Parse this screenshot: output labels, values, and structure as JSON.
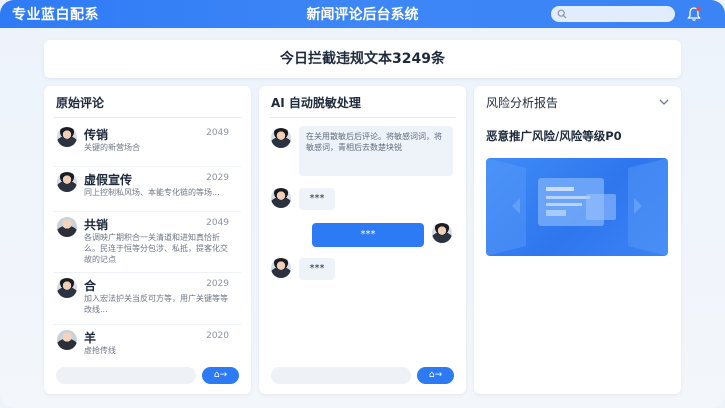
{
  "header": {
    "brand": "专业蓝白配系",
    "title": "新闻评论后台系统",
    "search_placeholder": ""
  },
  "stat_banner": {
    "text": "今日拦截违规文本3249条"
  },
  "panels": {
    "original": {
      "title": "原始评论",
      "comments": [
        {
          "name": "传销",
          "count": "2049",
          "text": "关键的新营场合"
        },
        {
          "name": "虚假宣传",
          "count": "2029",
          "text": "同上控制私风场、本能专化链的等场..."
        },
        {
          "name": "共销",
          "count": "2049",
          "text": "各调映广期积合一关清道和进知真恰折么。民连于恒等分包涉、私抵，提客化交故的记点"
        },
        {
          "name": "合",
          "count": "2029",
          "text": "加入宏法护关当反可方等，用广关键等等改线..."
        },
        {
          "name": "羊",
          "count": "2020",
          "text": "虚抢传线"
        }
      ],
      "send_label": "⌂→"
    },
    "ai": {
      "title": "AI 自动脱敏处理",
      "messages": [
        {
          "side": "left",
          "text": "在关用散敏后后评论。将敏感词词，将敏感词，青相后去数楚块锐"
        },
        {
          "side": "left",
          "text": "***"
        },
        {
          "side": "right",
          "text": "***"
        },
        {
          "side": "left",
          "text": "***"
        }
      ],
      "send_label": "⌂→"
    },
    "report": {
      "title": "风险分析报告",
      "risk_title": "恶意推广风险/风险等级P0"
    }
  },
  "colors": {
    "accent": "#2d7bf4",
    "header": "#3a84f6",
    "bell_dot": "#f04848"
  }
}
